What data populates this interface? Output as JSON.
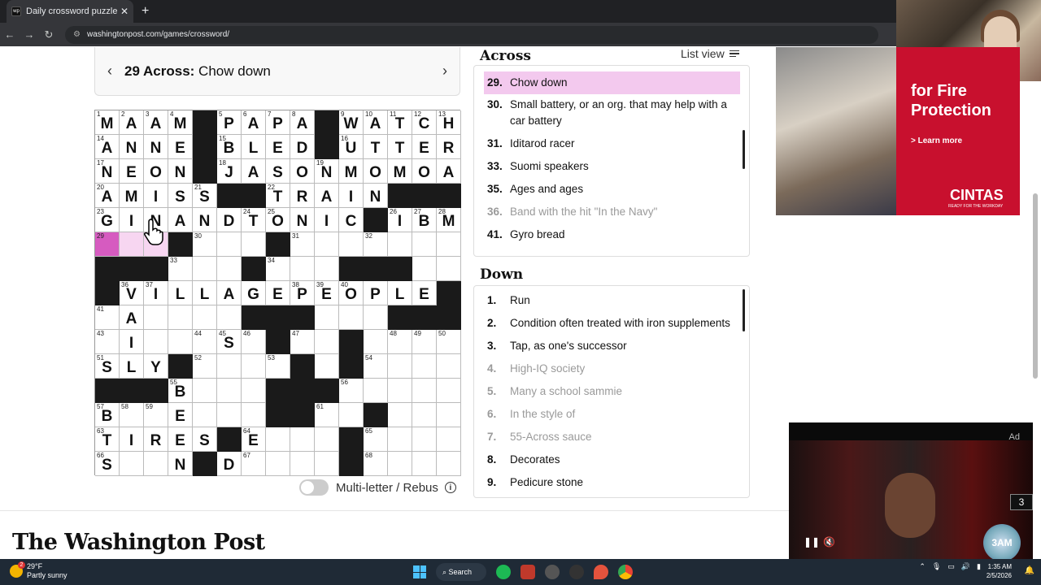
{
  "browser": {
    "tab_title": "Daily crossword puzzles free fr",
    "tab_favicon": "wp",
    "url": "washingtonpost.com/games/crossword/"
  },
  "clue_header": {
    "number_dir": "29 Across:",
    "text": "Chow down"
  },
  "grid": {
    "rows": [
      "MAAM#PAPA#WATCH",
      "ANNE#BLED#UTTER",
      "NEON#JASONMOMOA",
      "AMISS##TRAIN###",
      "GINANDTONIC#IBM",
      "...#...#.......",
      "###...#...###..",
      "#VILLAGEPEOPLE#",
      ".A....###...###",
      ".I...S.#..#....",
      "SLY#....#.#.....",
      "###B...###.....",
      "B..E...##..#...",
      "TIRES#E...#....",
      "S..N#D....#...."
    ],
    "numbers": [
      {
        "r": 0,
        "c": 0,
        "n": "1"
      },
      {
        "r": 0,
        "c": 1,
        "n": "2"
      },
      {
        "r": 0,
        "c": 2,
        "n": "3"
      },
      {
        "r": 0,
        "c": 3,
        "n": "4"
      },
      {
        "r": 0,
        "c": 5,
        "n": "5"
      },
      {
        "r": 0,
        "c": 6,
        "n": "6"
      },
      {
        "r": 0,
        "c": 7,
        "n": "7"
      },
      {
        "r": 0,
        "c": 8,
        "n": "8"
      },
      {
        "r": 0,
        "c": 10,
        "n": "9"
      },
      {
        "r": 0,
        "c": 11,
        "n": "10"
      },
      {
        "r": 0,
        "c": 12,
        "n": "11"
      },
      {
        "r": 0,
        "c": 13,
        "n": "12"
      },
      {
        "r": 0,
        "c": 14,
        "n": "13"
      },
      {
        "r": 1,
        "c": 0,
        "n": "14"
      },
      {
        "r": 1,
        "c": 5,
        "n": "15"
      },
      {
        "r": 1,
        "c": 10,
        "n": "16"
      },
      {
        "r": 2,
        "c": 0,
        "n": "17"
      },
      {
        "r": 2,
        "c": 5,
        "n": "18"
      },
      {
        "r": 2,
        "c": 9,
        "n": "19"
      },
      {
        "r": 3,
        "c": 0,
        "n": "20"
      },
      {
        "r": 3,
        "c": 4,
        "n": "21"
      },
      {
        "r": 3,
        "c": 7,
        "n": "22"
      },
      {
        "r": 4,
        "c": 0,
        "n": "23"
      },
      {
        "r": 4,
        "c": 6,
        "n": "24"
      },
      {
        "r": 4,
        "c": 7,
        "n": "25"
      },
      {
        "r": 4,
        "c": 12,
        "n": "26"
      },
      {
        "r": 4,
        "c": 13,
        "n": "27"
      },
      {
        "r": 4,
        "c": 14,
        "n": "28"
      },
      {
        "r": 5,
        "c": 0,
        "n": "29"
      },
      {
        "r": 5,
        "c": 4,
        "n": "30"
      },
      {
        "r": 5,
        "c": 8,
        "n": "31"
      },
      {
        "r": 5,
        "c": 11,
        "n": "32"
      },
      {
        "r": 6,
        "c": 3,
        "n": "33"
      },
      {
        "r": 6,
        "c": 7,
        "n": "34"
      },
      {
        "r": 6,
        "c": 11,
        "n": "35"
      },
      {
        "r": 7,
        "c": 1,
        "n": "36"
      },
      {
        "r": 7,
        "c": 2,
        "n": "37"
      },
      {
        "r": 7,
        "c": 8,
        "n": "38"
      },
      {
        "r": 7,
        "c": 9,
        "n": "39"
      },
      {
        "r": 7,
        "c": 10,
        "n": "40"
      },
      {
        "r": 8,
        "c": 0,
        "n": "41"
      },
      {
        "r": 8,
        "c": 7,
        "n": "42"
      },
      {
        "r": 9,
        "c": 0,
        "n": "43"
      },
      {
        "r": 9,
        "c": 4,
        "n": "44"
      },
      {
        "r": 9,
        "c": 5,
        "n": "45"
      },
      {
        "r": 9,
        "c": 6,
        "n": "46"
      },
      {
        "r": 9,
        "c": 8,
        "n": "47"
      },
      {
        "r": 9,
        "c": 12,
        "n": "48"
      },
      {
        "r": 9,
        "c": 13,
        "n": "49"
      },
      {
        "r": 9,
        "c": 14,
        "n": "50"
      },
      {
        "r": 10,
        "c": 0,
        "n": "51"
      },
      {
        "r": 10,
        "c": 4,
        "n": "52"
      },
      {
        "r": 10,
        "c": 7,
        "n": "53"
      },
      {
        "r": 10,
        "c": 11,
        "n": "54"
      },
      {
        "r": 11,
        "c": 3,
        "n": "55"
      },
      {
        "r": 11,
        "c": 10,
        "n": "56"
      },
      {
        "r": 12,
        "c": 0,
        "n": "57"
      },
      {
        "r": 12,
        "c": 1,
        "n": "58"
      },
      {
        "r": 12,
        "c": 2,
        "n": "59"
      },
      {
        "r": 12,
        "c": 8,
        "n": "60"
      },
      {
        "r": 12,
        "c": 9,
        "n": "61"
      },
      {
        "r": 12,
        "c": 11,
        "n": "62"
      },
      {
        "r": 13,
        "c": 0,
        "n": "63"
      },
      {
        "r": 13,
        "c": 6,
        "n": "64"
      },
      {
        "r": 13,
        "c": 11,
        "n": "65"
      },
      {
        "r": 14,
        "c": 0,
        "n": "66"
      },
      {
        "r": 14,
        "c": 6,
        "n": "67"
      },
      {
        "r": 14,
        "c": 11,
        "n": "68"
      }
    ],
    "selected": {
      "r": 5,
      "c": 0
    },
    "word_cells": [
      {
        "r": 5,
        "c": 1
      },
      {
        "r": 5,
        "c": 2
      }
    ]
  },
  "rebus_label": "Multi-letter / Rebus",
  "across": {
    "heading": "Across",
    "list_view": "List view",
    "clues": [
      {
        "n": "29.",
        "t": "Chow down",
        "state": "active"
      },
      {
        "n": "30.",
        "t": "Small battery, or an org. that may help with a car battery",
        "state": ""
      },
      {
        "n": "31.",
        "t": "Iditarod racer",
        "state": ""
      },
      {
        "n": "33.",
        "t": "Suomi speakers",
        "state": ""
      },
      {
        "n": "35.",
        "t": "Ages and ages",
        "state": ""
      },
      {
        "n": "36.",
        "t": "Band with the hit \"In the Navy\"",
        "state": "done"
      },
      {
        "n": "41.",
        "t": "Gyro bread",
        "state": ""
      }
    ]
  },
  "down": {
    "heading": "Down",
    "clues": [
      {
        "n": "1.",
        "t": "Run",
        "state": ""
      },
      {
        "n": "2.",
        "t": "Condition often treated with iron supplements",
        "state": ""
      },
      {
        "n": "3.",
        "t": "Tap, as one's successor",
        "state": ""
      },
      {
        "n": "4.",
        "t": "High-IQ society",
        "state": "done"
      },
      {
        "n": "5.",
        "t": "Many a school sammie",
        "state": "done"
      },
      {
        "n": "6.",
        "t": "In the style of",
        "state": "done"
      },
      {
        "n": "7.",
        "t": "55-Across sauce",
        "state": "done"
      },
      {
        "n": "8.",
        "t": "Decorates",
        "state": ""
      },
      {
        "n": "9.",
        "t": "Pedicure stone",
        "state": ""
      }
    ]
  },
  "ad": {
    "line1": "for Fire",
    "line2": "Protection",
    "learn": "> Learn more",
    "logo": "CINTAS",
    "tagline": "READY FOR THE WORKDAY"
  },
  "footer_logo": "The Washington Post",
  "video_ad": {
    "label": "Ad",
    "count": "3",
    "badge": "3AM"
  },
  "taskbar": {
    "temp": "29°F",
    "weather": "Partly sunny",
    "search": "Search",
    "time": "1:35 AM",
    "date": "2/5/2026"
  },
  "colors": {
    "selected_cell": "#d65bc0",
    "word_highlight": "#f7d6f1",
    "active_clue": "#f3c9ee",
    "ad_red": "#c8102e"
  }
}
